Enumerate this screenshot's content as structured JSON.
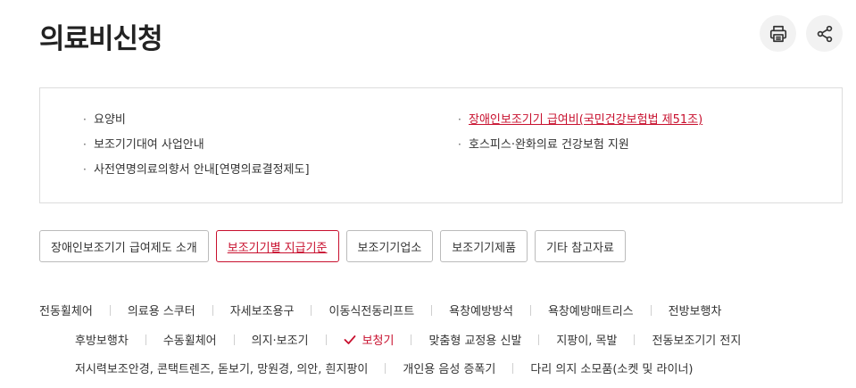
{
  "page": {
    "title": "의료비신청"
  },
  "actions": {
    "print_icon": "printer-icon",
    "share_icon": "share-icon"
  },
  "sub_menu": {
    "left": [
      {
        "label": "요양비",
        "active": false
      },
      {
        "label": "보조기기대여 사업안내",
        "active": false
      },
      {
        "label": "사전연명의료의향서 안내[연명의료결정제도]",
        "active": false
      }
    ],
    "right": [
      {
        "label": "장애인보조기기 급여비(국민건강보험법 제51조)",
        "active": true
      },
      {
        "label": "호스피스·완화의료 건강보험 지원",
        "active": false
      }
    ],
    "bullet": "·"
  },
  "tabs": [
    {
      "label": "장애인보조기기 급여제도 소개",
      "active": false
    },
    {
      "label": "보조기기별 지급기준",
      "active": true
    },
    {
      "label": "보조기기업소",
      "active": false
    },
    {
      "label": "보조기기제품",
      "active": false
    },
    {
      "label": "기타 참고자료",
      "active": false
    }
  ],
  "categories": {
    "row1": [
      "전동휠체어",
      "의료용 스쿠터",
      "자세보조용구",
      "이동식전동리프트",
      "욕창예방방석",
      "욕창예방매트리스",
      "전방보행차"
    ],
    "row2": [
      "후방보행차",
      "수동휠체어",
      "의지·보조기",
      "보청기",
      "맞춤형 교정용 신발",
      "지팡이, 목발",
      "전동보조기기 전지"
    ],
    "row3": [
      "저시력보조안경, 콘택트렌즈, 돋보기, 망원경, 의안, 흰지팡이",
      "개인용 음성 증폭기",
      "다리 의지 소모품(소켓 및 라이너)"
    ],
    "active": "보청기"
  },
  "colors": {
    "accent": "#c8102e",
    "border": "#dcdcdc",
    "icon_bg": "#f2f2f2"
  }
}
